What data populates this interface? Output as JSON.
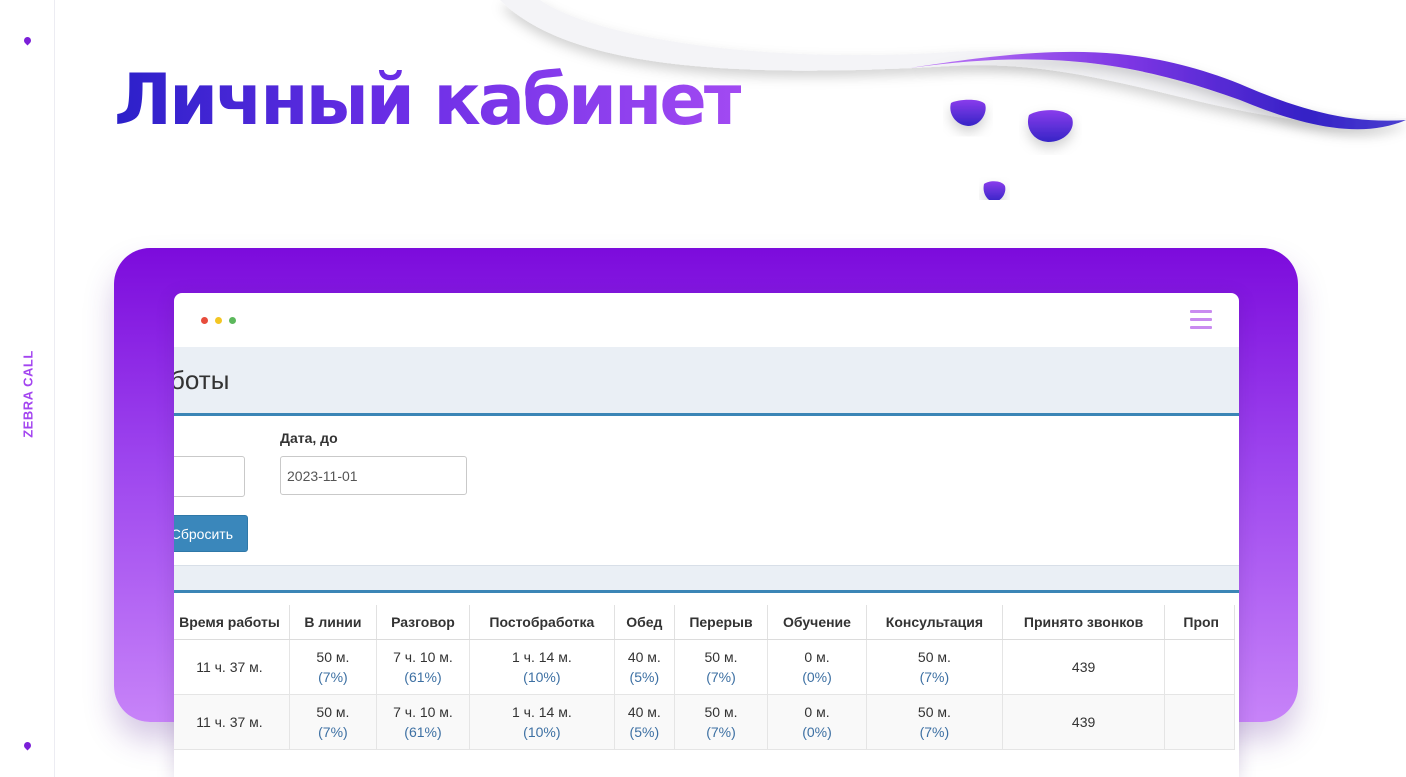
{
  "sidebar": {
    "brand_vertical": "ZEBRA CALL"
  },
  "page": {
    "title": "Личный кабинет"
  },
  "window": {
    "dot_colors": [
      "#e74c3c",
      "#f3c623",
      "#5cb85c"
    ],
    "menu_icon": "hamburger-icon",
    "section_heading": "боты",
    "date_to_label": "Дата, до",
    "date_to_value": "2023-11-01",
    "reset_label": "Сбросить"
  },
  "table": {
    "headers": [
      "Время работы",
      "В линии",
      "Разговор",
      "Постобработка",
      "Обед",
      "Перерыв",
      "Обучение",
      "Консультация",
      "Принято звонков",
      "Проп"
    ],
    "rows": [
      {
        "work_time": "11 ч. 37 м.",
        "in_line": "50 м.",
        "in_line_pct": "(7%)",
        "talk": "7 ч. 10 м.",
        "talk_pct": "(61%)",
        "post": "1 ч. 14 м.",
        "post_pct": "(10%)",
        "lunch": "40 м.",
        "lunch_pct": "(5%)",
        "break": "50 м.",
        "break_pct": "(7%)",
        "training": "0 м.",
        "training_pct": "(0%)",
        "consult": "50 м.",
        "consult_pct": "(7%)",
        "accepted": "439"
      },
      {
        "work_time": "11 ч. 37 м.",
        "in_line": "50 м.",
        "in_line_pct": "(7%)",
        "talk": "7 ч. 10 м.",
        "talk_pct": "(61%)",
        "post": "1 ч. 14 м.",
        "post_pct": "(10%)",
        "lunch": "40 м.",
        "lunch_pct": "(5%)",
        "break": "50 м.",
        "break_pct": "(7%)",
        "training": "0 м.",
        "training_pct": "(0%)",
        "consult": "50 м.",
        "consult_pct": "(7%)",
        "accepted": "439"
      }
    ]
  },
  "colors": {
    "accent": "#7c0bdc",
    "brand_text": "#a344f0",
    "table_link": "#3d70a3",
    "button": "#3a87bb"
  }
}
